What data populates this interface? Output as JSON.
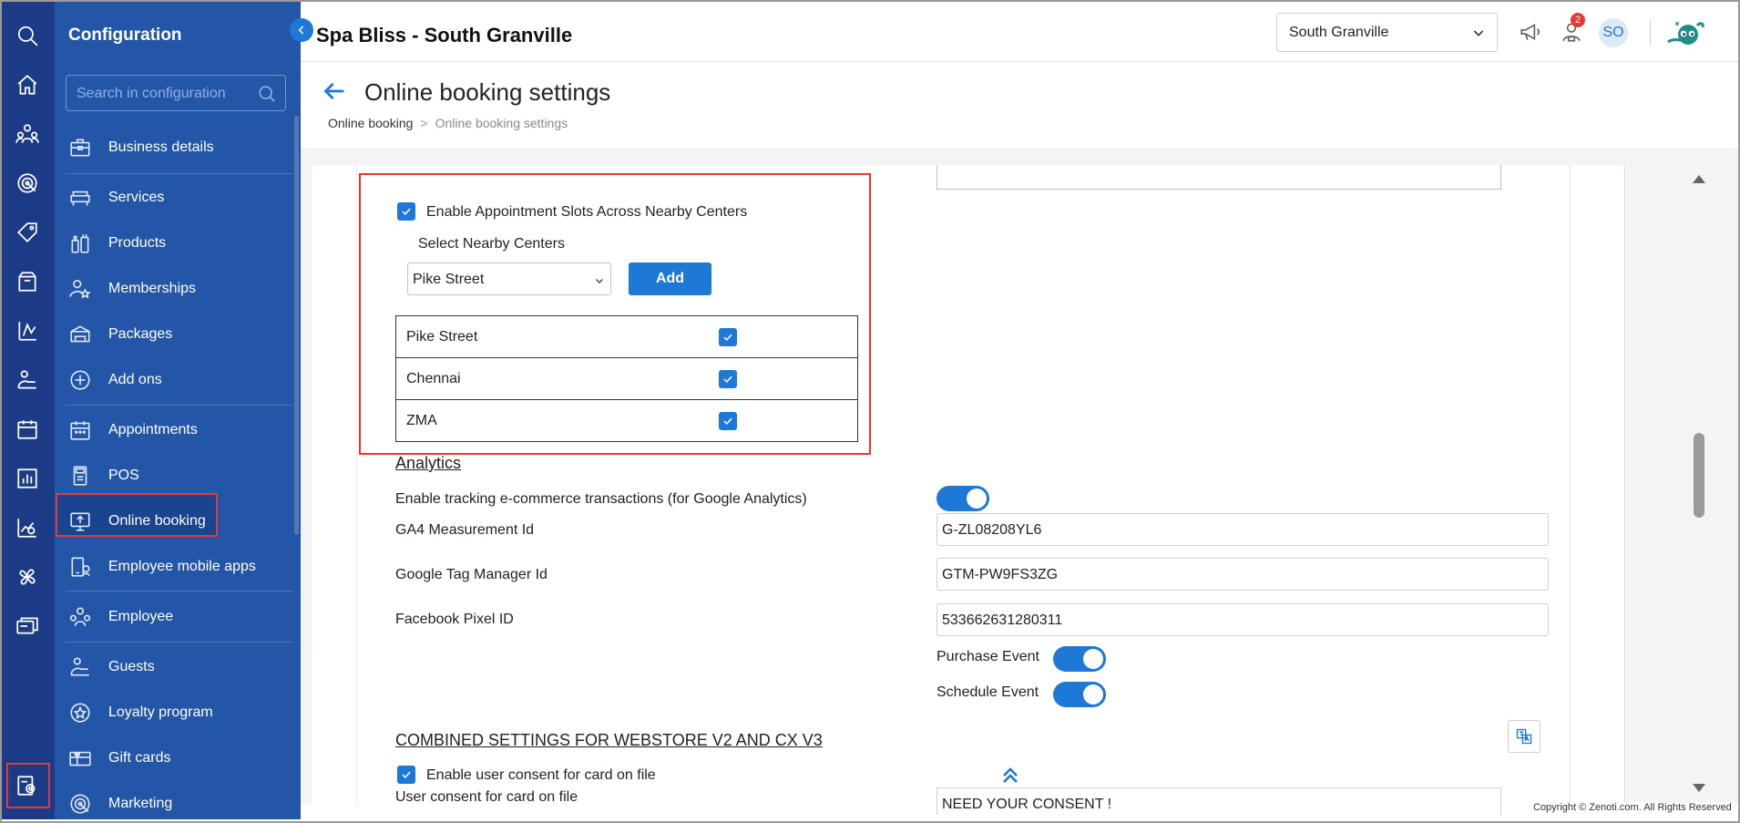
{
  "app": {
    "title": "Spa Bliss - South Granville"
  },
  "topbar": {
    "location": "South Granville",
    "notification_count": "2",
    "avatar_initials": "SO"
  },
  "sidebar": {
    "title": "Configuration",
    "search_placeholder": "Search in configuration",
    "items": [
      {
        "label": "Business details",
        "icon": "briefcase-icon"
      },
      {
        "label": "Services",
        "icon": "sofa-icon"
      },
      {
        "label": "Products",
        "icon": "bottles-icon"
      },
      {
        "label": "Memberships",
        "icon": "member-star-icon"
      },
      {
        "label": "Packages",
        "icon": "package-icon"
      },
      {
        "label": "Add ons",
        "icon": "plus-circle-icon"
      },
      {
        "label": "Appointments",
        "icon": "calendar-icon"
      },
      {
        "label": "POS",
        "icon": "pos-icon"
      },
      {
        "label": "Online booking",
        "icon": "monitor-upload-icon"
      },
      {
        "label": "Employee mobile apps",
        "icon": "mobile-app-icon"
      },
      {
        "label": "Employee",
        "icon": "employee-group-icon"
      },
      {
        "label": "Guests",
        "icon": "guest-icon"
      },
      {
        "label": "Loyalty program",
        "icon": "loyalty-star-icon"
      },
      {
        "label": "Gift cards",
        "icon": "gift-card-icon"
      },
      {
        "label": "Marketing",
        "icon": "marketing-target-icon"
      }
    ]
  },
  "header": {
    "page_title": "Online booking settings",
    "breadcrumb": {
      "parent": "Online booking",
      "separator": ">",
      "current": "Online booking settings"
    }
  },
  "nearby": {
    "enable_label": "Enable Appointment Slots Across Nearby Centers",
    "enabled": true,
    "select_label": "Select Nearby Centers",
    "selected_center": "Pike Street",
    "add_label": "Add",
    "centers": [
      {
        "name": "Pike Street",
        "checked": true
      },
      {
        "name": "Chennai",
        "checked": true
      },
      {
        "name": "ZMA",
        "checked": true
      }
    ]
  },
  "analytics": {
    "heading": "Analytics",
    "tracking_label": "Enable tracking e-commerce transactions (for Google Analytics)",
    "tracking_enabled": true,
    "ga4_label": "GA4 Measurement Id",
    "ga4_value": "G-ZL08208YL6",
    "gtm_label": "Google Tag Manager Id",
    "gtm_value": "GTM-PW9FS3ZG",
    "fb_label": "Facebook Pixel ID",
    "fb_value": "533662631280311",
    "purchase_event_label": "Purchase Event",
    "purchase_event_enabled": true,
    "schedule_event_label": "Schedule Event",
    "schedule_event_enabled": true
  },
  "combined": {
    "heading": "COMBINED SETTINGS FOR WEBSTORE V2 AND CX V3",
    "consent_enable_label": "Enable user consent for card on file",
    "consent_enabled": true,
    "consent_label": "User consent for card on file",
    "consent_value": "NEED YOUR CONSENT !"
  },
  "footer": {
    "copyright": "Copyright © Zenoti.com. All Rights Reserved"
  },
  "colors": {
    "rail": "#1c3b86",
    "sidebar": "#2356a6",
    "accent": "#1e78d6",
    "highlight": "#e53935"
  }
}
